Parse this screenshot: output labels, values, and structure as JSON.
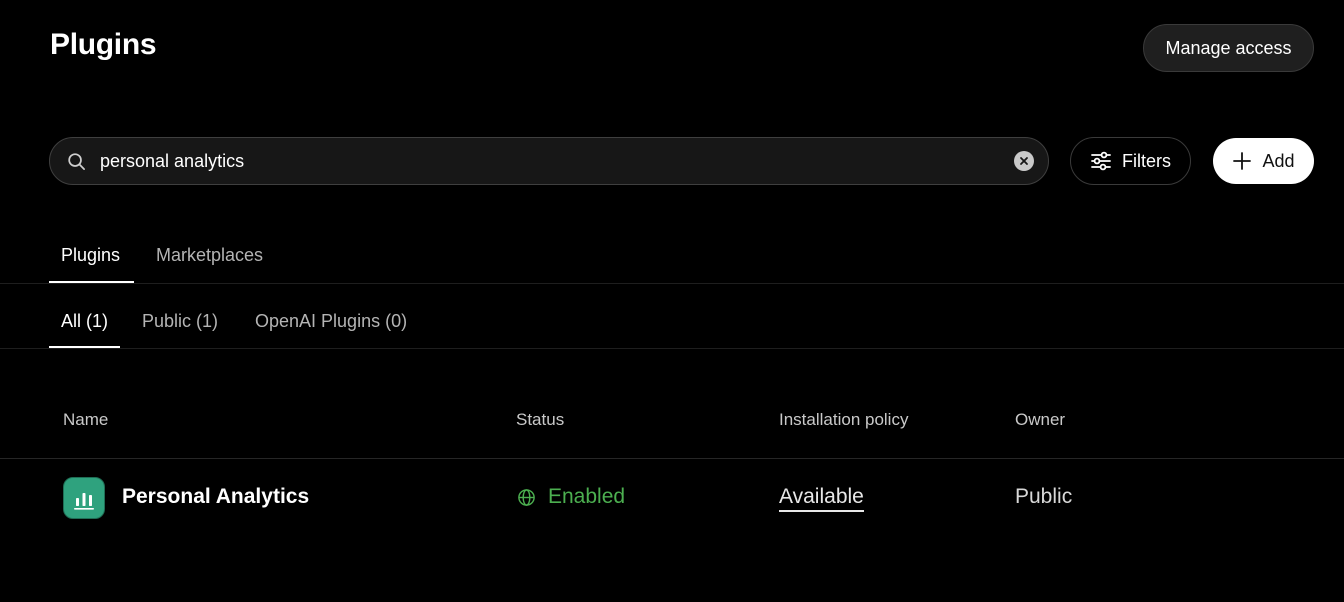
{
  "header": {
    "title": "Plugins",
    "manage_access_label": "Manage access"
  },
  "search": {
    "value": "personal analytics",
    "placeholder": ""
  },
  "toolbar": {
    "filters_label": "Filters",
    "add_label": "Add"
  },
  "main_tabs": [
    {
      "label": "Plugins",
      "active": true
    },
    {
      "label": "Marketplaces",
      "active": false
    }
  ],
  "sub_tabs": [
    {
      "label": "All (1)",
      "active": true
    },
    {
      "label": "Public (1)",
      "active": false
    },
    {
      "label": "OpenAI Plugins (0)",
      "active": false
    }
  ],
  "table": {
    "columns": [
      "Name",
      "Status",
      "Installation policy",
      "Owner"
    ],
    "rows": [
      {
        "name": "Personal Analytics",
        "icon": "bar-chart-icon",
        "status": "Enabled",
        "status_icon": "globe-icon",
        "installation_policy": "Available",
        "owner": "Public"
      }
    ]
  },
  "colors": {
    "background": "#000000",
    "status_enabled": "#4caf50",
    "plugin_icon_bg": "#2fa27e"
  }
}
